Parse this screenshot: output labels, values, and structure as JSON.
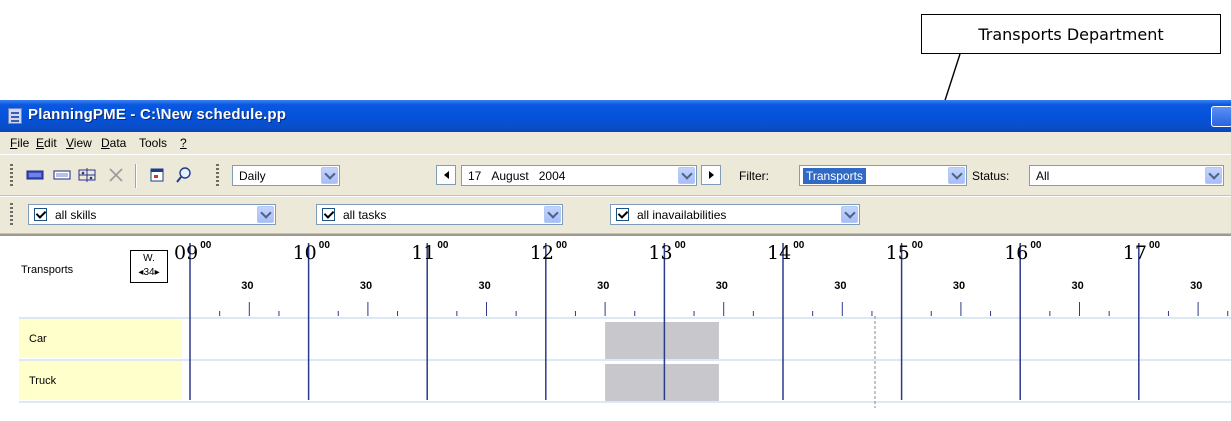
{
  "callout": {
    "text": "Transports Department"
  },
  "window": {
    "title": "PlanningPME - C:\\New schedule.pp"
  },
  "menu": [
    {
      "key": "F",
      "rest": "ile"
    },
    {
      "key": "E",
      "rest": "dit"
    },
    {
      "key": "V",
      "rest": "iew"
    },
    {
      "key": "D",
      "rest": "ata"
    },
    {
      "key": "",
      "rest": "Tools"
    },
    {
      "key": "?",
      "rest": ""
    }
  ],
  "toolbar": {
    "icons": [
      "resource-view-icon",
      "task-view-icon",
      "unavailability-icon",
      "delete-icon",
      "window-icon",
      "find-icon"
    ],
    "view_mode": "Daily",
    "date": {
      "day": "17",
      "month": "August",
      "year": "2004"
    },
    "filter_label": "Filter:",
    "filter_value": "Transports",
    "status_label": "Status:",
    "status_value": "All"
  },
  "toolbar2": {
    "skills": "all skills",
    "tasks": "all tasks",
    "inavailabilities": "all inavailabilities"
  },
  "schedule": {
    "group": "Transports",
    "week_label": "W.",
    "week_number": "34",
    "hours": [
      "09",
      "10",
      "11",
      "12",
      "13",
      "14",
      "15",
      "16",
      "17"
    ],
    "minutes_label": "00",
    "half_label": "30",
    "rows": [
      {
        "name": "Car"
      },
      {
        "name": "Truck"
      }
    ],
    "colors": {
      "row_label_bg": "#ffffcc",
      "hour_line": "#2c3a8c",
      "task_block": "#c8c8cc",
      "title_bar": "#0a58e0"
    }
  }
}
